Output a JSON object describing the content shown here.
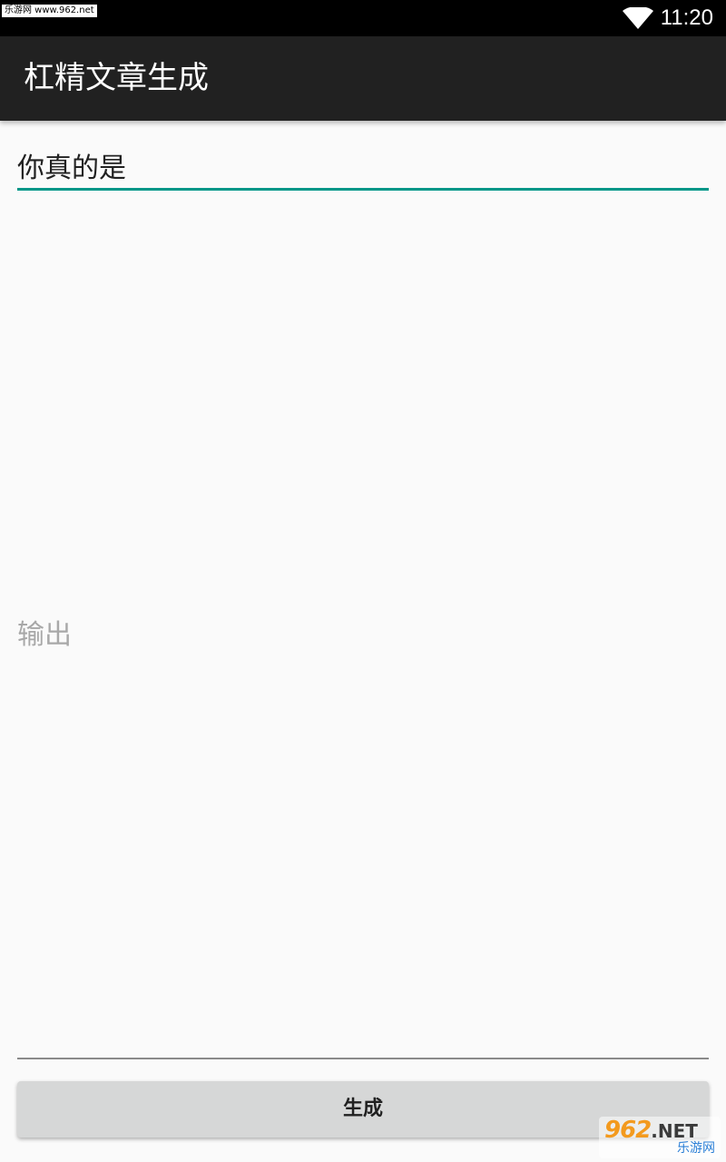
{
  "status_bar": {
    "time": "11:20",
    "watermark": "乐游网 www.962.net",
    "wifi_icon": "wifi-icon",
    "background": "#000000"
  },
  "app_bar": {
    "title": "杠精文章生成",
    "background": "#212121"
  },
  "input": {
    "value": "你真的是",
    "accent_color": "#009688"
  },
  "output": {
    "hint": "输出",
    "value": ""
  },
  "generate_button": {
    "label": "生成"
  },
  "watermark_logo": {
    "number": "962",
    "suffix": ".NET",
    "chinese": "乐游网"
  }
}
